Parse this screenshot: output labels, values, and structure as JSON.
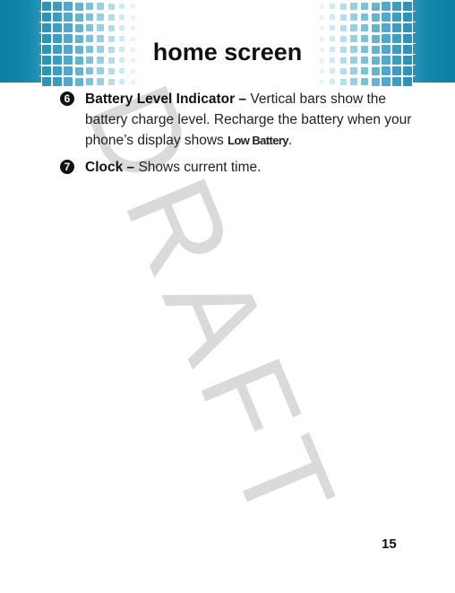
{
  "header": {
    "title": "home screen",
    "accent_color": "#0a7fa3"
  },
  "watermark": {
    "text": "DRAFT",
    "color": "#dadada"
  },
  "items": [
    {
      "number": "6",
      "term": "Battery Level Indicator –",
      "text_before": " Vertical bars show the battery charge level. Recharge the battery when your phone’s display shows ",
      "display_text": "Low Battery",
      "text_after": "."
    },
    {
      "number": "7",
      "term": "Clock –",
      "text_before": " Shows current time.",
      "display_text": "",
      "text_after": ""
    }
  ],
  "footer": {
    "page_number": "15"
  }
}
